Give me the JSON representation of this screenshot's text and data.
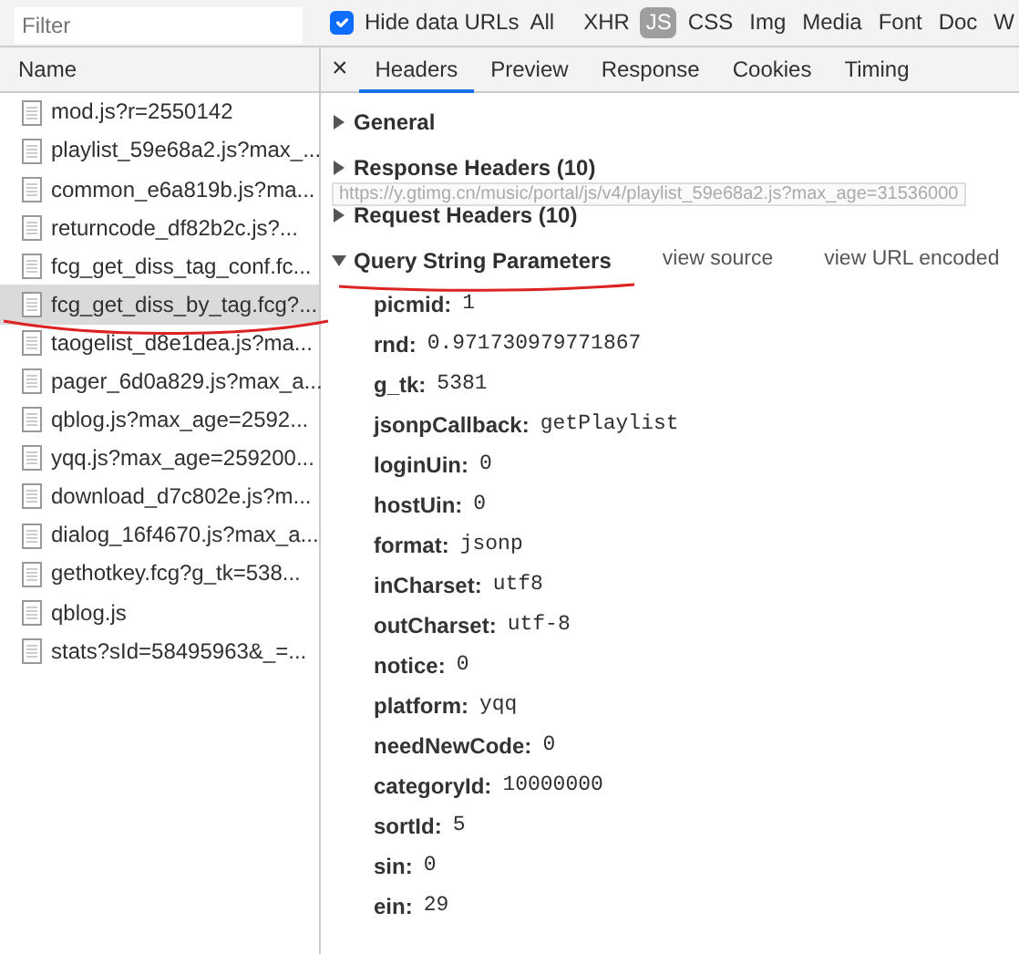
{
  "filter": {
    "placeholder": "Filter"
  },
  "hide_data_urls": {
    "label": "Hide data URLs",
    "checked": true
  },
  "type_filters": [
    {
      "label": "All",
      "selected": false
    },
    {
      "label": "XHR",
      "selected": false
    },
    {
      "label": "JS",
      "selected": true
    },
    {
      "label": "CSS",
      "selected": false
    },
    {
      "label": "Img",
      "selected": false
    },
    {
      "label": "Media",
      "selected": false
    },
    {
      "label": "Font",
      "selected": false
    },
    {
      "label": "Doc",
      "selected": false
    },
    {
      "label": "W",
      "selected": false
    }
  ],
  "requests": {
    "column": "Name",
    "rows": [
      {
        "name": "mod.js?r=2550142",
        "selected": false
      },
      {
        "name": "playlist_59e68a2.js?max_...",
        "selected": false
      },
      {
        "name": "common_e6a819b.js?ma...",
        "selected": false
      },
      {
        "name": "returncode_df82b2c.js?...",
        "selected": false
      },
      {
        "name": "fcg_get_diss_tag_conf.fc...",
        "selected": false
      },
      {
        "name": "fcg_get_diss_by_tag.fcg?...",
        "selected": true
      },
      {
        "name": "taogelist_d8e1dea.js?ma...",
        "selected": false
      },
      {
        "name": "pager_6d0a829.js?max_a...",
        "selected": false
      },
      {
        "name": "qblog.js?max_age=2592...",
        "selected": false
      },
      {
        "name": "yqq.js?max_age=259200...",
        "selected": false
      },
      {
        "name": "download_d7c802e.js?m...",
        "selected": false
      },
      {
        "name": "dialog_16f4670.js?max_a...",
        "selected": false
      },
      {
        "name": "gethotkey.fcg?g_tk=538...",
        "selected": false
      },
      {
        "name": "qblog.js",
        "selected": false
      },
      {
        "name": "stats?sId=58495963&_=...",
        "selected": false
      }
    ]
  },
  "tooltip": "https://y.gtimg.cn/music/portal/js/v4/playlist_59e68a2.js?max_age=31536000",
  "close": "×",
  "tabs": [
    {
      "label": "Headers",
      "selected": true
    },
    {
      "label": "Preview",
      "selected": false
    },
    {
      "label": "Response",
      "selected": false
    },
    {
      "label": "Cookies",
      "selected": false
    },
    {
      "label": "Timing",
      "selected": false
    }
  ],
  "sections": [
    {
      "title": "General",
      "expanded": false
    },
    {
      "title": "Response Headers (10)",
      "expanded": false
    },
    {
      "title": "Request Headers (10)",
      "expanded": false
    },
    {
      "title": "Query String Parameters",
      "expanded": true,
      "links": [
        "view source",
        "view URL encoded"
      ],
      "params": [
        {
          "key": "picmid:",
          "value": "1"
        },
        {
          "key": "rnd:",
          "value": "0.971730979771867"
        },
        {
          "key": "g_tk:",
          "value": "5381"
        },
        {
          "key": "jsonpCallback:",
          "value": "getPlaylist"
        },
        {
          "key": "loginUin:",
          "value": "0"
        },
        {
          "key": "hostUin:",
          "value": "0"
        },
        {
          "key": "format:",
          "value": "jsonp"
        },
        {
          "key": "inCharset:",
          "value": "utf8"
        },
        {
          "key": "outCharset:",
          "value": "utf-8"
        },
        {
          "key": "notice:",
          "value": "0"
        },
        {
          "key": "platform:",
          "value": "yqq"
        },
        {
          "key": "needNewCode:",
          "value": "0"
        },
        {
          "key": "categoryId:",
          "value": "10000000"
        },
        {
          "key": "sortId:",
          "value": "5"
        },
        {
          "key": "sin:",
          "value": "0"
        },
        {
          "key": "ein:",
          "value": "29"
        }
      ]
    }
  ]
}
